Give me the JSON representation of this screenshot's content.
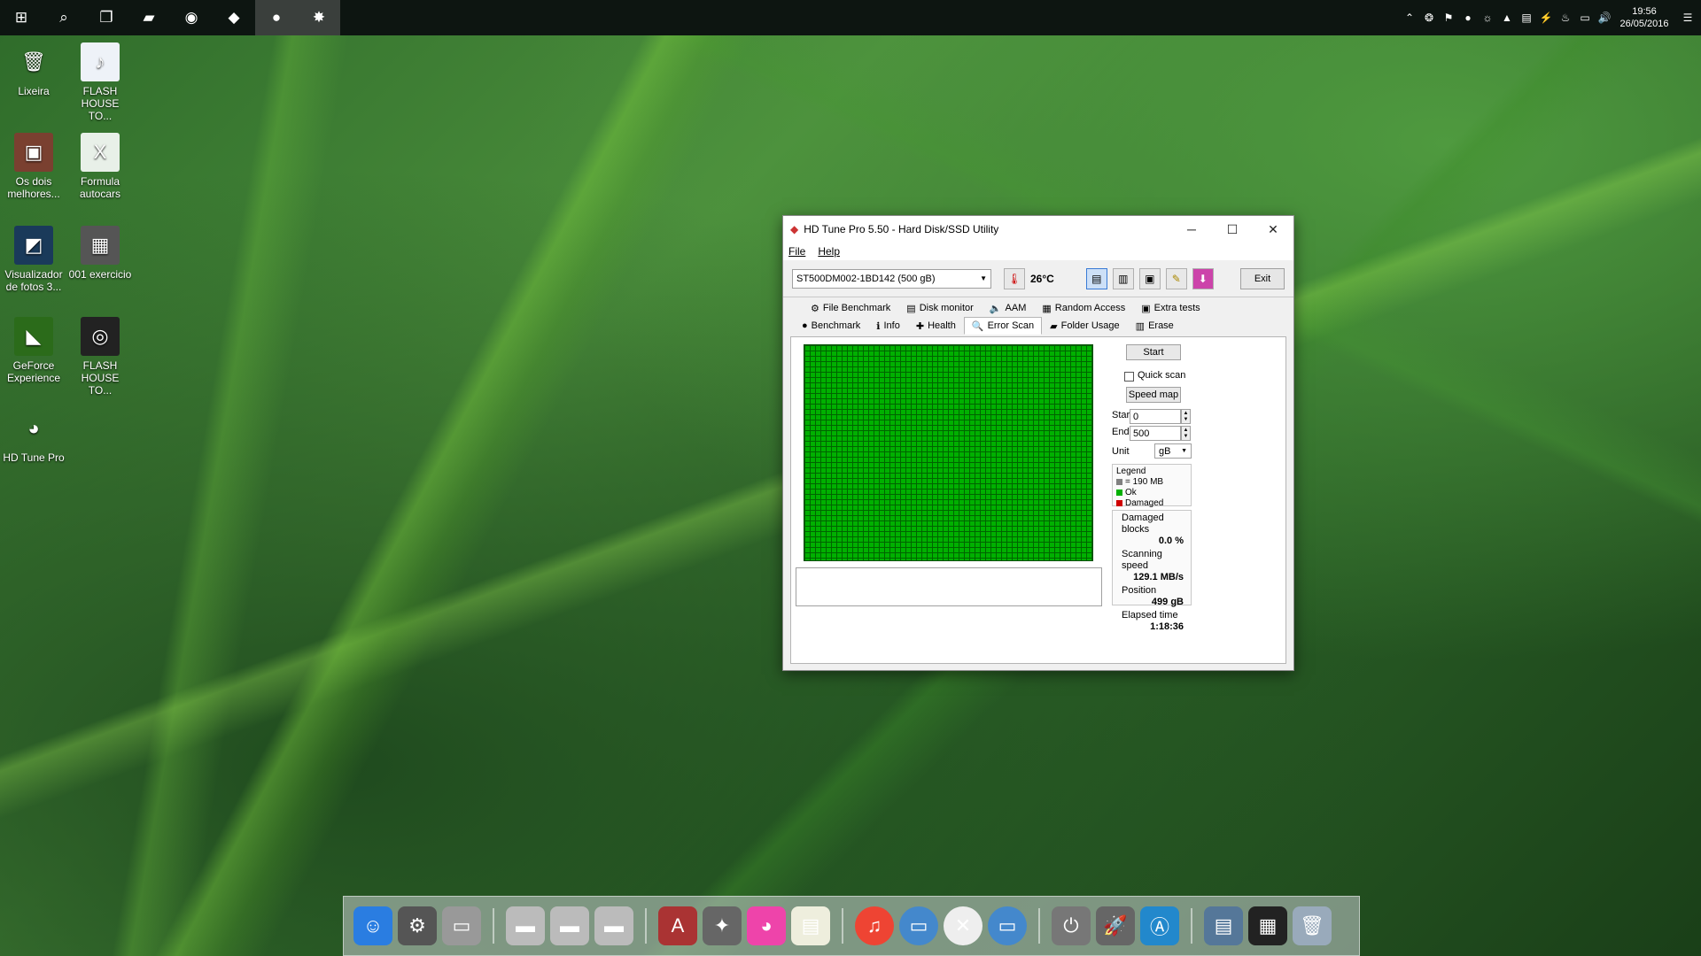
{
  "taskbar": {
    "items": [
      {
        "name": "start-icon",
        "glyph": "⊞"
      },
      {
        "name": "search-icon",
        "glyph": "⌕"
      },
      {
        "name": "task-view-icon",
        "glyph": "❐"
      },
      {
        "name": "file-explorer-icon",
        "glyph": "▰"
      },
      {
        "name": "chrome-icon",
        "glyph": "◉"
      },
      {
        "name": "app-icon",
        "glyph": "◆"
      },
      {
        "name": "hdtune-icon",
        "glyph": "●"
      },
      {
        "name": "avast-icon",
        "glyph": "✸"
      }
    ],
    "tray": [
      "⌃",
      "❂",
      "⚑",
      "●",
      "☼",
      "▲",
      "▤",
      "⚡",
      "♨",
      "▭",
      "🔊"
    ],
    "time": "19:56",
    "date": "26/05/2016",
    "notif": "☰"
  },
  "desktop": [
    {
      "name": "recycle-bin",
      "label": "Lixeira",
      "glyph": "🗑",
      "bg": "transparent"
    },
    {
      "name": "mp3-file",
      "label": "FLASH HOUSE TO...",
      "glyph": "♪",
      "bg": "#eef2f8"
    },
    {
      "name": "shortcut-os-dois",
      "label": "Os dois melhores...",
      "glyph": "▣",
      "bg": "#7a4030"
    },
    {
      "name": "excel-file",
      "label": "Formula autocars",
      "glyph": "X",
      "bg": "#e8f0e8"
    },
    {
      "name": "photo-viewer",
      "label": "Visualizador de fotos 3...",
      "glyph": "◩",
      "bg": "#1a3a5a"
    },
    {
      "name": "exercise-file",
      "label": "001 exercicio",
      "glyph": "▦",
      "bg": "#555"
    },
    {
      "name": "geforce",
      "label": "GeForce Experience",
      "glyph": "◣",
      "bg": "#2b6b1a"
    },
    {
      "name": "flash-house",
      "label": "FLASH HOUSE TO...",
      "glyph": "◎",
      "bg": "#222"
    },
    {
      "name": "hdtune-pro",
      "label": "HD Tune Pro",
      "glyph": "◕",
      "bg": "transparent"
    }
  ],
  "window": {
    "title": "HD Tune Pro 5.50 - Hard Disk/SSD Utility",
    "menu": [
      "File",
      "Help"
    ],
    "drive": "ST500DM002-1BD142 (500 gB)",
    "temperature": "26°C",
    "exit": "Exit",
    "tabs_top": [
      {
        "label": "File Benchmark",
        "icon": "⚙"
      },
      {
        "label": "Disk monitor",
        "icon": "▤"
      },
      {
        "label": "AAM",
        "icon": "🔈"
      },
      {
        "label": "Random Access",
        "icon": "▦"
      },
      {
        "label": "Extra tests",
        "icon": "▣"
      }
    ],
    "tabs_bottom": [
      {
        "label": "Benchmark",
        "icon": "●"
      },
      {
        "label": "Info",
        "icon": "ℹ"
      },
      {
        "label": "Health",
        "icon": "✚"
      },
      {
        "label": "Error Scan",
        "icon": "🔍"
      },
      {
        "label": "Folder Usage",
        "icon": "▰"
      },
      {
        "label": "Erase",
        "icon": "▥"
      }
    ],
    "selected_tab": "Error Scan",
    "start": "Start",
    "quick_scan": "Quick scan",
    "speed_map": "Speed map",
    "start_label": "Start",
    "start_value": "0",
    "end_label": "End",
    "end_value": "500",
    "unit_label": "Unit",
    "unit": "gB",
    "legend": {
      "title": "Legend",
      "block": "= 190 MB",
      "ok": "Ok",
      "damaged": "Damaged"
    },
    "stats": {
      "damaged_label": "Damaged blocks",
      "damaged": "0.0 %",
      "speed_label": "Scanning speed",
      "speed": "129.1 MB/s",
      "position_label": "Position",
      "position": "499 gB",
      "elapsed_label": "Elapsed time",
      "elapsed": "1:18:36"
    }
  },
  "colors": {
    "ok": "#00b000",
    "damaged": "#d00000",
    "block": "#808080"
  },
  "dock": [
    "☺",
    "⚙",
    "▭",
    "|",
    "▬",
    "▬",
    "▬",
    "|",
    "A",
    "✦",
    "◕",
    "▤",
    "|",
    "♫",
    "▭",
    "✕",
    "▭",
    "|",
    "⏻",
    "🚀",
    "Ⓐ",
    "|",
    "▤",
    "▦",
    "🗑"
  ]
}
